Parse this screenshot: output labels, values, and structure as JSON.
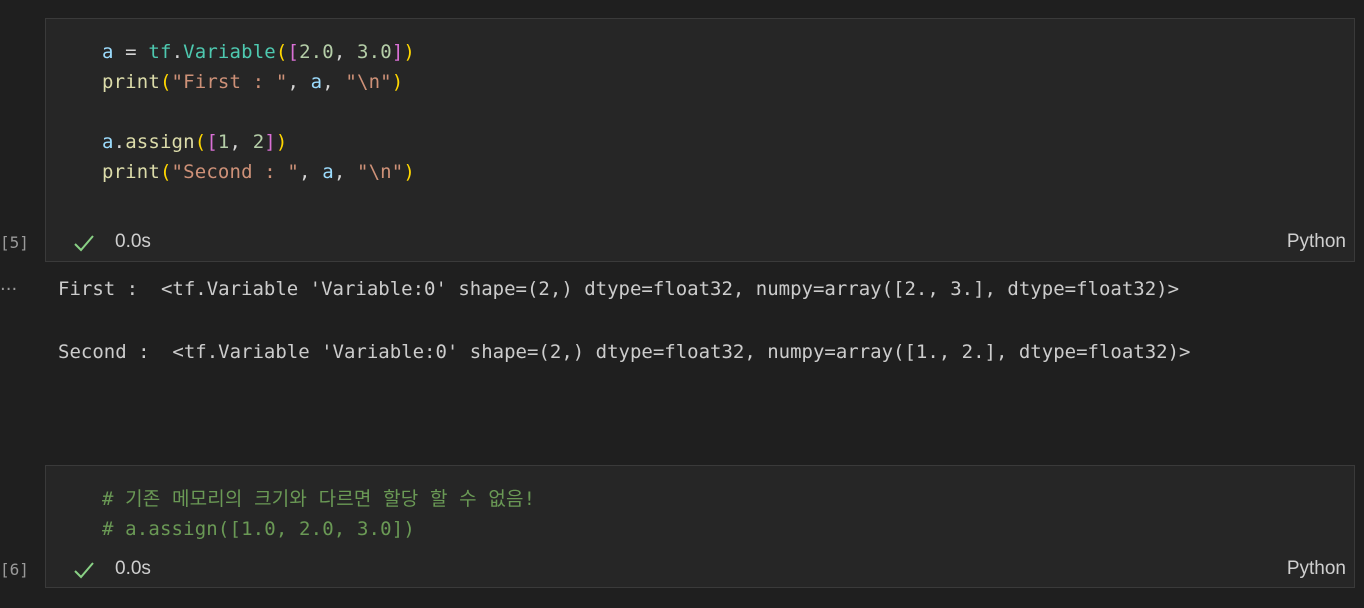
{
  "colors": {
    "background": "#1f1f1f",
    "cell_background": "#262626",
    "variable": "#9cdcfe",
    "module": "#4ec9b0",
    "function": "#dcdcaa",
    "string": "#ce9178",
    "number": "#b5cea8",
    "comment": "#6a9955",
    "bracket_level1": "#ffd700",
    "bracket_level2": "#da70d6",
    "success_check": "#89d185"
  },
  "cells": [
    {
      "execution_count": "[5]",
      "language": "Python",
      "status_icon": "check-icon",
      "duration": "0.0s",
      "code_lines": [
        "a = tf.Variable([2.0, 3.0])",
        "print(\"First : \", a, \"\\n\")",
        "",
        "a.assign([1, 2])",
        "print(\"Second : \", a, \"\\n\")"
      ],
      "tokens": {
        "l0": [
          "a",
          " = ",
          "tf",
          ".",
          "Variable",
          "(",
          "[",
          "2.0",
          ", ",
          "3.0",
          "]",
          ")"
        ],
        "l1": [
          "print",
          "(",
          "\"First : \"",
          ", ",
          "a",
          ", ",
          "\"\\n\"",
          ")"
        ],
        "l3": [
          "a",
          ".",
          "assign",
          "(",
          "[",
          "1",
          ", ",
          "2",
          "]",
          ")"
        ],
        "l4": [
          "print",
          "(",
          "\"Second : \"",
          ", ",
          "a",
          ", ",
          "\"\\n\"",
          ")"
        ]
      },
      "output": {
        "more_icon": "ellipsis-icon",
        "lines": [
          "First :  <tf.Variable 'Variable:0' shape=(2,) dtype=float32, numpy=array([2., 3.], dtype=float32)>",
          "Second :  <tf.Variable 'Variable:0' shape=(2,) dtype=float32, numpy=array([1., 2.], dtype=float32)>"
        ]
      }
    },
    {
      "execution_count": "[6]",
      "language": "Python",
      "status_icon": "check-icon",
      "duration": "0.0s",
      "code_lines": [
        "# 기존 메모리의 크기와 다르면 할당 할 수 없음!",
        "# a.assign([1.0, 2.0, 3.0])"
      ]
    }
  ]
}
